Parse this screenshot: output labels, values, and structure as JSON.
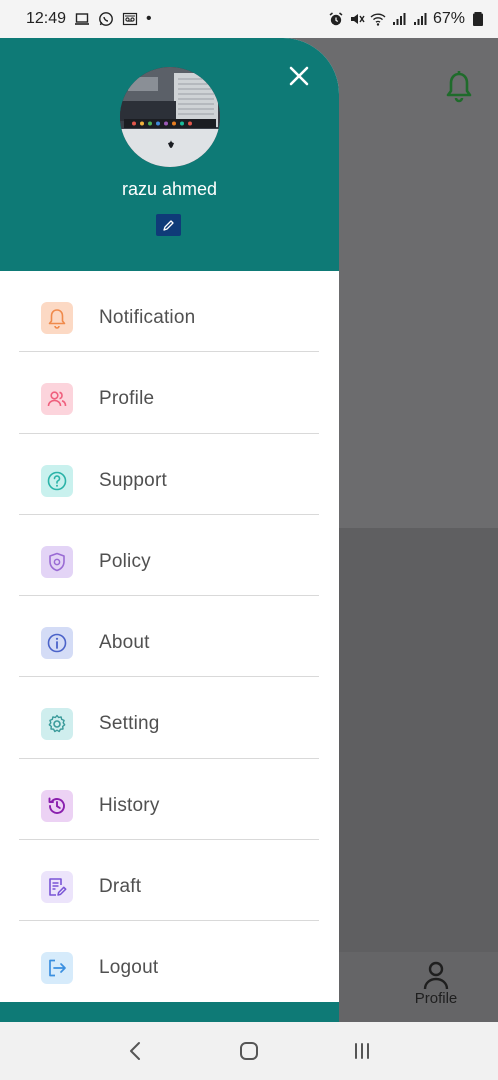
{
  "status_bar": {
    "time": "12:49",
    "dot": "•",
    "battery": "67%",
    "icons": [
      "laptop-icon",
      "whatsapp-icon",
      "voicemail-icon",
      "alarm-icon",
      "mute-icon",
      "wifi-icon",
      "signal-icon",
      "signal-icon",
      "battery-icon"
    ]
  },
  "drawer": {
    "user_name": "razu ahmed",
    "header_color": "#0e7a76",
    "items": [
      {
        "label": "Notification",
        "icon": "bell-icon",
        "bg": "#fcd9c4",
        "color": "#f08a4b"
      },
      {
        "label": "Profile",
        "icon": "users-icon",
        "bg": "#fcd4dc",
        "color": "#ef5f7d"
      },
      {
        "label": "Support",
        "icon": "help-circle-icon",
        "bg": "#c9f1ee",
        "color": "#2bb3a8"
      },
      {
        "label": "Policy",
        "icon": "shield-icon",
        "bg": "#e3d4f6",
        "color": "#9a6bd4"
      },
      {
        "label": "About",
        "icon": "info-icon",
        "bg": "#d4dcf6",
        "color": "#4b63c9"
      },
      {
        "label": "Setting",
        "icon": "gear-icon",
        "bg": "#cfeeee",
        "color": "#3a9a9a"
      },
      {
        "label": "History",
        "icon": "history-icon",
        "bg": "#ecd2f4",
        "color": "#8a1fae"
      },
      {
        "label": "Draft",
        "icon": "document-edit-icon",
        "bg": "#ece4fb",
        "color": "#7a55d6"
      },
      {
        "label": "Logout",
        "icon": "logout-icon",
        "bg": "#d6ebfb",
        "color": "#3a8fe0"
      }
    ]
  },
  "background_screen": {
    "bottom_nav_label": "Profile"
  }
}
